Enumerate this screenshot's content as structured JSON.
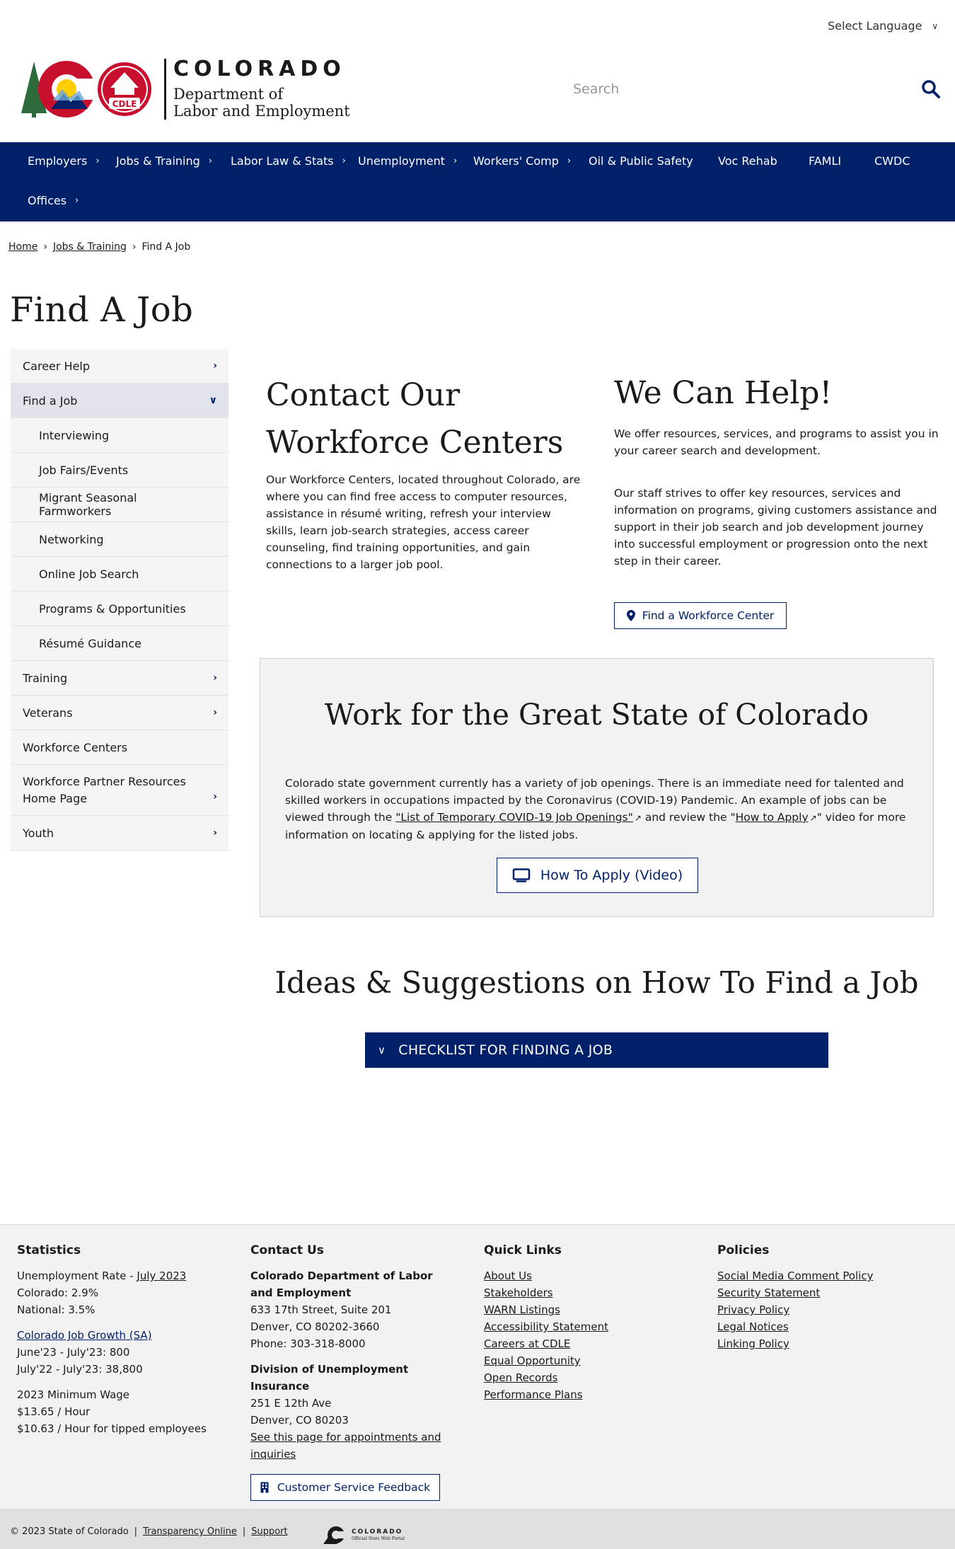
{
  "header": {
    "language_label": "Select Language",
    "logo": {
      "word1": "COLORADO",
      "word2": "Department of",
      "word3": "Labor and Employment",
      "badge": "CDLE"
    },
    "search_placeholder": "Search"
  },
  "nav": [
    {
      "label": "Employers",
      "has_submenu": true
    },
    {
      "label": "Jobs & Training",
      "has_submenu": true
    },
    {
      "label": "Labor Law & Stats",
      "has_submenu": true
    },
    {
      "label": "Unemployment",
      "has_submenu": true
    },
    {
      "label": "Workers' Comp",
      "has_submenu": true
    },
    {
      "label": "Oil & Public Safety",
      "has_submenu": false
    },
    {
      "label": "Voc Rehab",
      "has_submenu": false
    },
    {
      "label": "FAMLI",
      "has_submenu": false
    },
    {
      "label": "CWDC",
      "has_submenu": false
    },
    {
      "label": "Offices",
      "has_submenu": true
    }
  ],
  "breadcrumb": {
    "home": "Home",
    "section": "Jobs & Training",
    "current": "Find A Job"
  },
  "page_title": "Find A Job",
  "sidebar": [
    {
      "label": "Career Help"
    },
    {
      "label": "Find a Job"
    },
    {
      "label": "Interviewing"
    },
    {
      "label": "Job Fairs/Events"
    },
    {
      "label": "Migrant Seasonal Farmworkers"
    },
    {
      "label": "Networking"
    },
    {
      "label": "Online Job Search"
    },
    {
      "label": "Programs & Opportunities"
    },
    {
      "label": "Résumé Guidance"
    },
    {
      "label": "Training"
    },
    {
      "label": "Veterans"
    },
    {
      "label": "Workforce Centers"
    },
    {
      "label": "Workforce Partner Resources Home Page"
    },
    {
      "label": "Youth"
    }
  ],
  "contact": {
    "title": "Contact Our Workforce Centers",
    "body": "Our Workforce Centers, located throughout Colorado, are where you can find free access to computer resources, assistance in résumé writing, refresh your interview skills, learn job-search strategies, access career counseling, find training opportunities, and gain connections to a larger job pool."
  },
  "help": {
    "title": "We Can Help!",
    "p1": "We offer resources, services, and programs to assist you in your career search and development.",
    "p2": "Our staff strives to offer key resources, services and information on programs, giving customers assistance and support in their job search and job development journey into successful employment or progression onto the next step in their career.",
    "button": "Find a Workforce Center"
  },
  "state": {
    "title": "Work for the Great State of Colorado",
    "text1": "Colorado state government currently has a variety of job openings. There is an immediate need for talented and skilled workers in occupations impacted by the Coronavirus (COVID-19) Pandemic. An example of jobs can be viewed through the ",
    "link1": "\"List of Temporary COVID-19 Job Openings\"",
    "text2": " and review the \"",
    "link2": "How to Apply",
    "text3": "\" video for more information on locating & applying for the listed jobs.",
    "button": "How To Apply (Video)"
  },
  "ideas": {
    "title": "Ideas & Suggestions on How To Find a Job",
    "accordion": "CHECKLIST FOR FINDING A JOB"
  },
  "footer": {
    "stats": {
      "heading": "Statistics",
      "unemp_label": "Unemployment Rate - ",
      "unemp_link": "July 2023",
      "colorado": "Colorado: 2.9%",
      "national": "National: 3.5%",
      "growth_link": "Colorado Job Growth (SA)",
      "growth1": "June'23 - July'23: 800",
      "growth2": "July'22 - July'23: 38,800",
      "wage_title": "2023 Minimum Wage",
      "wage1": "$13.65 / Hour",
      "wage2": "$10.63 / Hour for tipped employees"
    },
    "contact": {
      "heading": "Contact Us",
      "org": "Colorado Department of Labor and Employment",
      "addr1": "633 17th Street, Suite 201",
      "addr2": "Denver, CO  80202-3660",
      "phone": "Phone: 303-318-8000",
      "div": "Division of Unemployment Insurance",
      "div_addr1": "251 E 12th Ave",
      "div_addr2": "Denver, CO  80203",
      "appt_link": "See this page for appointments and inquiries",
      "feedback": "Customer Service Feedback"
    },
    "quick": {
      "heading": "Quick Links",
      "links": [
        "About Us",
        "Stakeholders",
        "WARN Listings",
        "Accessibility Statement",
        "Careers at CDLE",
        "Equal Opportunity",
        "Open Records",
        "Performance Plans"
      ]
    },
    "policies": {
      "heading": "Policies",
      "links": [
        "Social Media Comment Policy",
        "Security Statement",
        "Privacy Policy",
        "Legal Notices",
        "Linking Policy"
      ]
    }
  },
  "bottom": {
    "copyright": "© 2023 State of Colorado",
    "sep": "|",
    "transparency": "Transparency Online",
    "support": "Support",
    "state_logo_word": "COLORADO",
    "state_logo_sub": "Official State Web Portal"
  },
  "colors": {
    "primary": "#002169",
    "sidebar_bg": "#f5f5f5",
    "footer_bg": "#f2f2f2"
  }
}
